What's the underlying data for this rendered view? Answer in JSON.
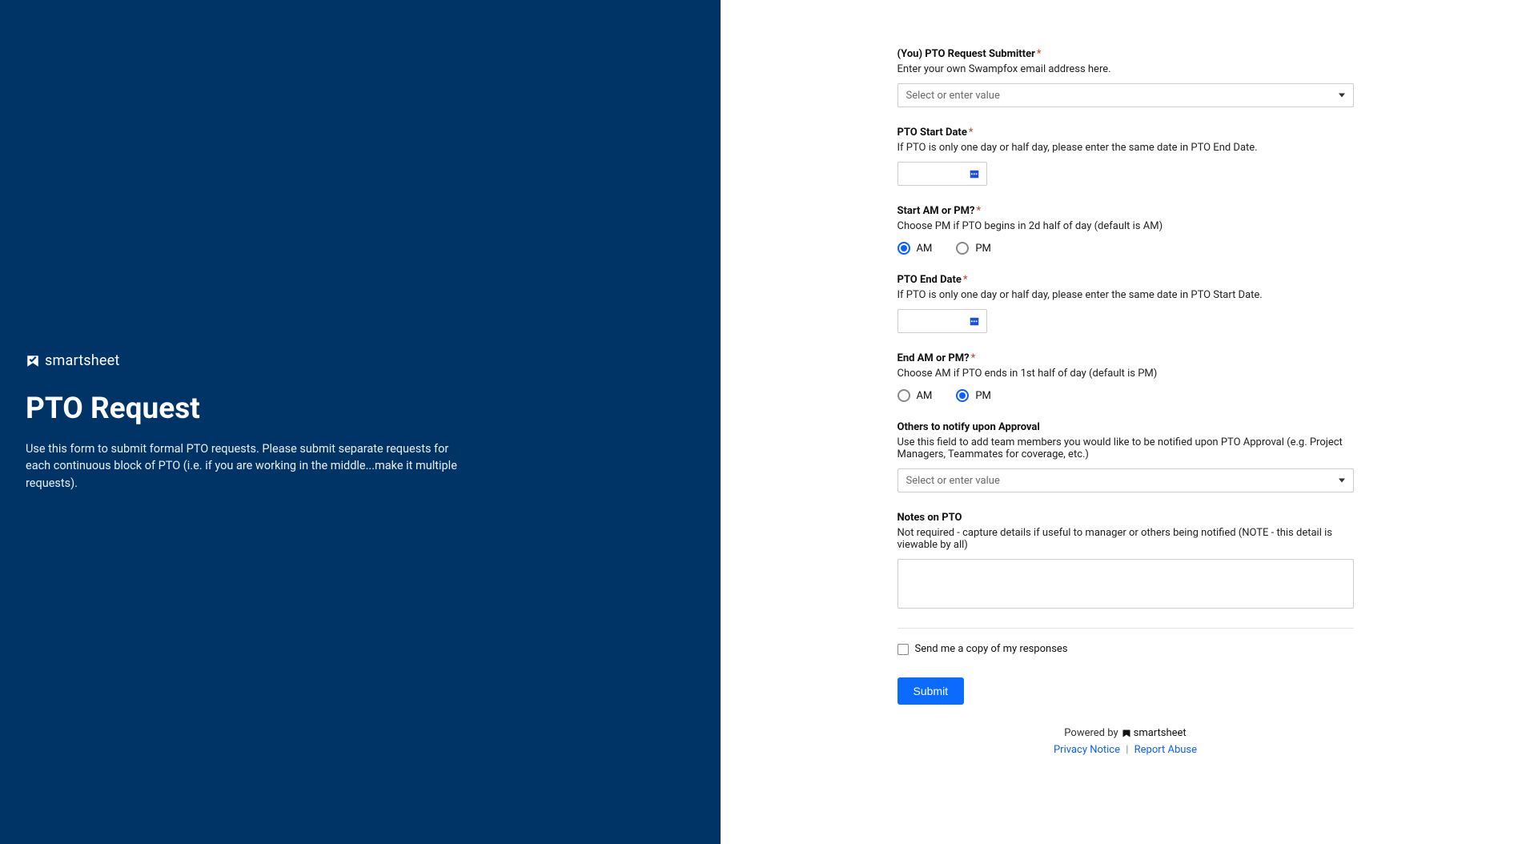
{
  "left": {
    "brand": "smartsheet",
    "title": "PTO Request",
    "description": "Use this form to submit formal PTO requests. Please submit separate requests for each continuous block of PTO (i.e. if you are working in the middle...make it multiple requests)."
  },
  "form": {
    "submitter": {
      "label": "(You) PTO Request Submitter",
      "help": "Enter your own Swampfox email address here.",
      "placeholder": "Select or enter value"
    },
    "start_date": {
      "label": "PTO Start Date",
      "help": "If PTO is only one day or half day, please enter the same date in PTO End Date."
    },
    "start_ampm": {
      "label": "Start AM or PM?",
      "help": "Choose PM if PTO begins in 2d half of day (default is AM)",
      "options": [
        "AM",
        "PM"
      ],
      "selected": "AM"
    },
    "end_date": {
      "label": "PTO End Date",
      "help": "If PTO is only one day or half day, please enter the same date in PTO Start Date."
    },
    "end_ampm": {
      "label": "End AM or PM?",
      "help": "Choose AM if PTO ends in 1st half of day (default is PM)",
      "options": [
        "AM",
        "PM"
      ],
      "selected": "PM"
    },
    "notify": {
      "label": "Others to notify upon Approval",
      "help": "Use this field to add team members you would like to be notified upon PTO Approval (e.g. Project Managers, Teammates for coverage, etc.)",
      "placeholder": "Select or enter value"
    },
    "notes": {
      "label": "Notes on PTO",
      "help": "Not required - capture details if useful to manager or others being notified (NOTE - this detail is viewable by all)"
    },
    "copy_checkbox_label": "Send me a copy of my responses",
    "submit_label": "Submit"
  },
  "footer": {
    "powered_by": "Powered by",
    "brand": "smartsheet",
    "privacy": "Privacy Notice",
    "separator": "|",
    "report": "Report Abuse"
  }
}
